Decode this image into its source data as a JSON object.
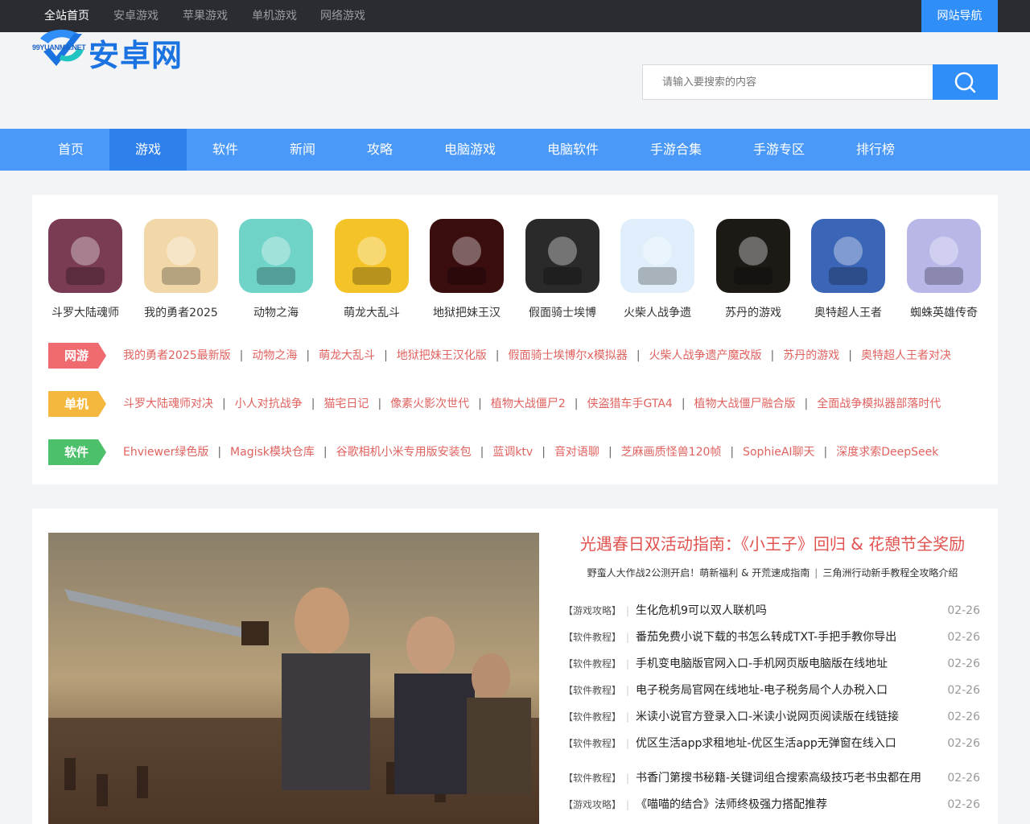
{
  "topbar": {
    "links": [
      "全站首页",
      "安卓游戏",
      "苹果游戏",
      "单机游戏",
      "网络游戏"
    ],
    "nav_button": "网站导航"
  },
  "logo": {
    "mark_text": "99YUANMA.NET",
    "name": "安卓网"
  },
  "search": {
    "placeholder": "请输入要搜索的内容"
  },
  "mainnav": [
    "首页",
    "游戏",
    "软件",
    "新闻",
    "攻略",
    "电脑游戏",
    "电脑软件",
    "手游合集",
    "手游专区",
    "排行榜"
  ],
  "games": [
    {
      "name": "斗罗大陆魂师",
      "icon": "douluo-game-icon",
      "color": "#7a3b55"
    },
    {
      "name": "我的勇者2025",
      "icon": "brave-hero-game-icon",
      "color": "#f2d8a8"
    },
    {
      "name": "动物之海",
      "icon": "animal-sea-game-icon",
      "color": "#6fd3c8"
    },
    {
      "name": "萌龙大乱斗",
      "icon": "dragon-egg-game-icon",
      "color": "#f4c327"
    },
    {
      "name": "地狱把妹王汉",
      "icon": "helltaker-game-icon",
      "color": "#3a0d0f"
    },
    {
      "name": "假面骑士埃博",
      "icon": "kamen-rider-game-icon",
      "color": "#2a2a2a"
    },
    {
      "name": "火柴人战争遗",
      "icon": "stickman-war-game-icon",
      "color": "#dfeefa"
    },
    {
      "name": "苏丹的游戏",
      "icon": "sultan-game-icon",
      "color": "#1d1a16"
    },
    {
      "name": "奥特超人王者",
      "icon": "ultraman-game-icon",
      "color": "#3b66b8"
    },
    {
      "name": "蜘蛛英雄传奇",
      "icon": "spider-hero-game-icon",
      "color": "#b9b6e8"
    }
  ],
  "tag_rows": [
    {
      "tag": "网游",
      "links": [
        "我的勇者2025最新版",
        "动物之海",
        "萌龙大乱斗",
        "地狱把妹王汉化版",
        "假面骑士埃博尔x模拟器",
        "火柴人战争遗产魔改版",
        "苏丹的游戏",
        "奥特超人王者对决"
      ]
    },
    {
      "tag": "单机",
      "links": [
        "斗罗大陆魂师对决",
        "小人对抗战争",
        "猫宅日记",
        "像素火影次世代",
        "植物大战僵尸2",
        "侠盗猎车手GTA4",
        "植物大战僵尸融合版",
        "全面战争模拟器部落时代"
      ]
    },
    {
      "tag": "软件",
      "links": [
        "Ehviewer绿色版",
        "Magisk模块仓库",
        "谷歌相机小米专用版安装包",
        "蓝调ktv",
        "音对语聊",
        "芝麻画质怪兽120帧",
        "SophieAI聊天",
        "深度求索DeepSeek"
      ]
    }
  ],
  "headline": "光遇春日双活动指南：《小王子》回归 & 花憩节全奖励",
  "subline": [
    "野蛮人大作战2公测开启！萌新福利 & 开荒速成指南",
    "三角洲行动新手教程全攻略介绍"
  ],
  "news": [
    {
      "cat": "【游戏攻略】",
      "title": "生化危机9可以双人联机吗",
      "date": "02-26"
    },
    {
      "cat": "【软件教程】",
      "title": "番茄免费小说下载的书怎么转成TXT-手把手教你导出",
      "date": "02-26"
    },
    {
      "cat": "【软件教程】",
      "title": "手机变电脑版官网入口-手机网页版电脑版在线地址",
      "date": "02-26"
    },
    {
      "cat": "【软件教程】",
      "title": "电子税务局官网在线地址-电子税务局个人办税入口",
      "date": "02-26"
    },
    {
      "cat": "【软件教程】",
      "title": "米读小说官方登录入口-米读小说网页阅读版在线链接",
      "date": "02-26"
    },
    {
      "cat": "【软件教程】",
      "title": "优区生活app求租地址-优区生活app无弹窗在线入口",
      "date": "02-26"
    },
    {
      "cat": "【软件教程】",
      "title": "书香门第搜书秘籍-关键词组合搜索高级技巧老书虫都在用",
      "date": "02-26"
    },
    {
      "cat": "【游戏攻略】",
      "title": "《喵喵的结合》法师终极强力搭配推荐",
      "date": "02-26"
    }
  ],
  "colors": {
    "accent": "#2f8ef7",
    "nav": "#4a98f7",
    "link_red": "#e0625f"
  }
}
